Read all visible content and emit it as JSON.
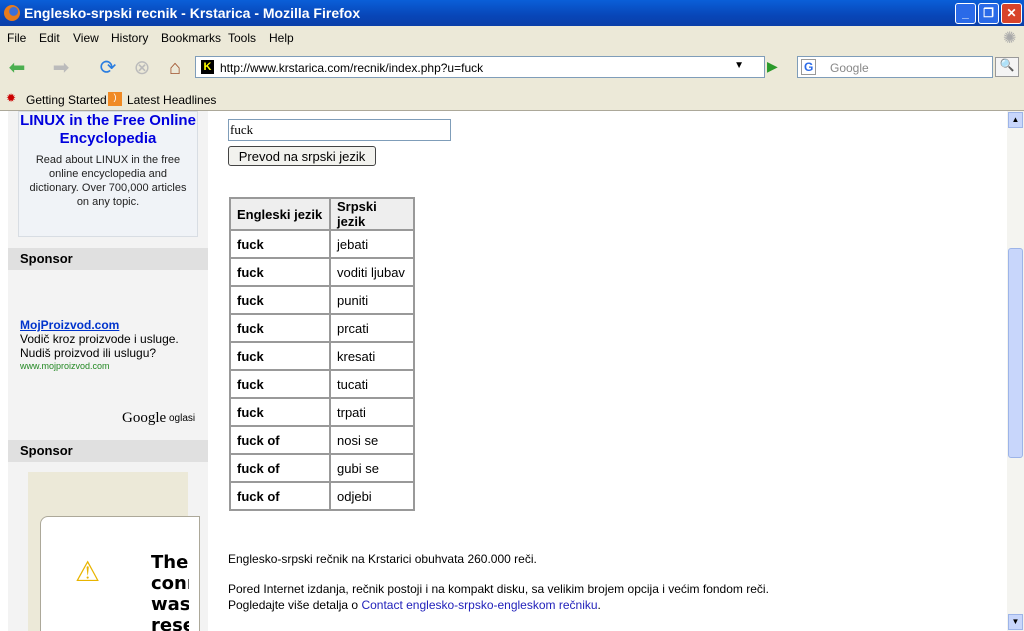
{
  "window": {
    "title": "Englesko-srpski recnik - Krstarica - Mozilla Firefox"
  },
  "menu": [
    "File",
    "Edit",
    "View",
    "History",
    "Bookmarks",
    "Tools",
    "Help"
  ],
  "toolbar": {
    "url": "http://www.krstarica.com/recnik/index.php?u=fuck",
    "search_placeholder": "Google"
  },
  "bookmarks": [
    "Getting Started",
    "Latest Headlines"
  ],
  "sidebar": {
    "ad_title": "LINUX in the Free Online Encyclopedia",
    "ad_body": "Read about LINUX in the free online encyclopedia and dictionary. Over 700,000 articles on any topic.",
    "sponsor1": "Sponsor",
    "ad2_link": "MojProizvod.com",
    "ad2_line1": "Vodič kroz proizvode i usluge.",
    "ad2_line2": "Nudiš proizvod ili uslugu?",
    "ad2_url": "www.mojproizvod.com",
    "google_logo": "Google",
    "google_suffix": "oglasi",
    "sponsor2": "Sponsor",
    "error_text": [
      "The",
      "conn",
      "was",
      "rese"
    ]
  },
  "main": {
    "query": "fuck",
    "translate_button": "Prevod na srpski jezik",
    "headers": [
      "Engleski jezik",
      "Srpski jezik"
    ],
    "rows": [
      [
        "fuck",
        "jebati"
      ],
      [
        "fuck",
        "voditi ljubav"
      ],
      [
        "fuck",
        "puniti"
      ],
      [
        "fuck",
        "prcati"
      ],
      [
        "fuck",
        "kresati"
      ],
      [
        "fuck",
        "tucati"
      ],
      [
        "fuck",
        "trpati"
      ],
      [
        "fuck of",
        "nosi se"
      ],
      [
        "fuck of",
        "gubi se"
      ],
      [
        "fuck of",
        "odjebi"
      ]
    ],
    "info1": "Englesko-srpski rečnik na Krstarici obuhvata 260.000 reči.",
    "info2": "Pored Internet izdanja, rečnik postoji i na kompakt disku, sa velikim brojem opcija i većim fondom reči.",
    "info3_prefix": "Pogledajte više detalja o ",
    "info3_link": "Contact englesko-srpsko-engleskom rečniku",
    "info3_suffix": "."
  }
}
